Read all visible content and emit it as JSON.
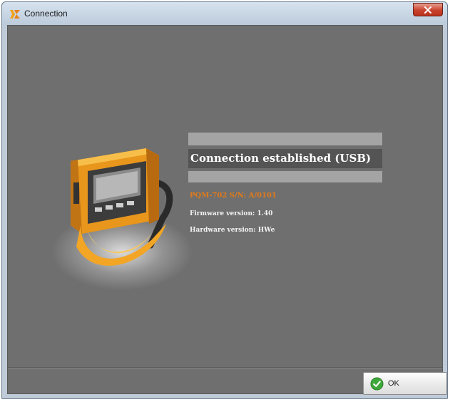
{
  "window": {
    "title": "Connection",
    "close_label": "X"
  },
  "connection": {
    "status": "Connection established (USB)",
    "device_serial": "PQM-702 S/N: A/0101",
    "firmware": "Firmware version: 1.40",
    "hardware": "Hardware version: HWe"
  },
  "footer": {
    "ok_label": "OK"
  },
  "icons": {
    "app": "app-logo-icon",
    "close": "close-icon",
    "device": "meter-device-image",
    "ok": "check-icon"
  },
  "colors": {
    "client_background": "#6f6f6f",
    "status_bar": "#545454",
    "status_rule": "#a4a4a4",
    "serial_text": "#e07a1a",
    "close_button": "#c8432d",
    "ok_check": "#3ea83a"
  }
}
